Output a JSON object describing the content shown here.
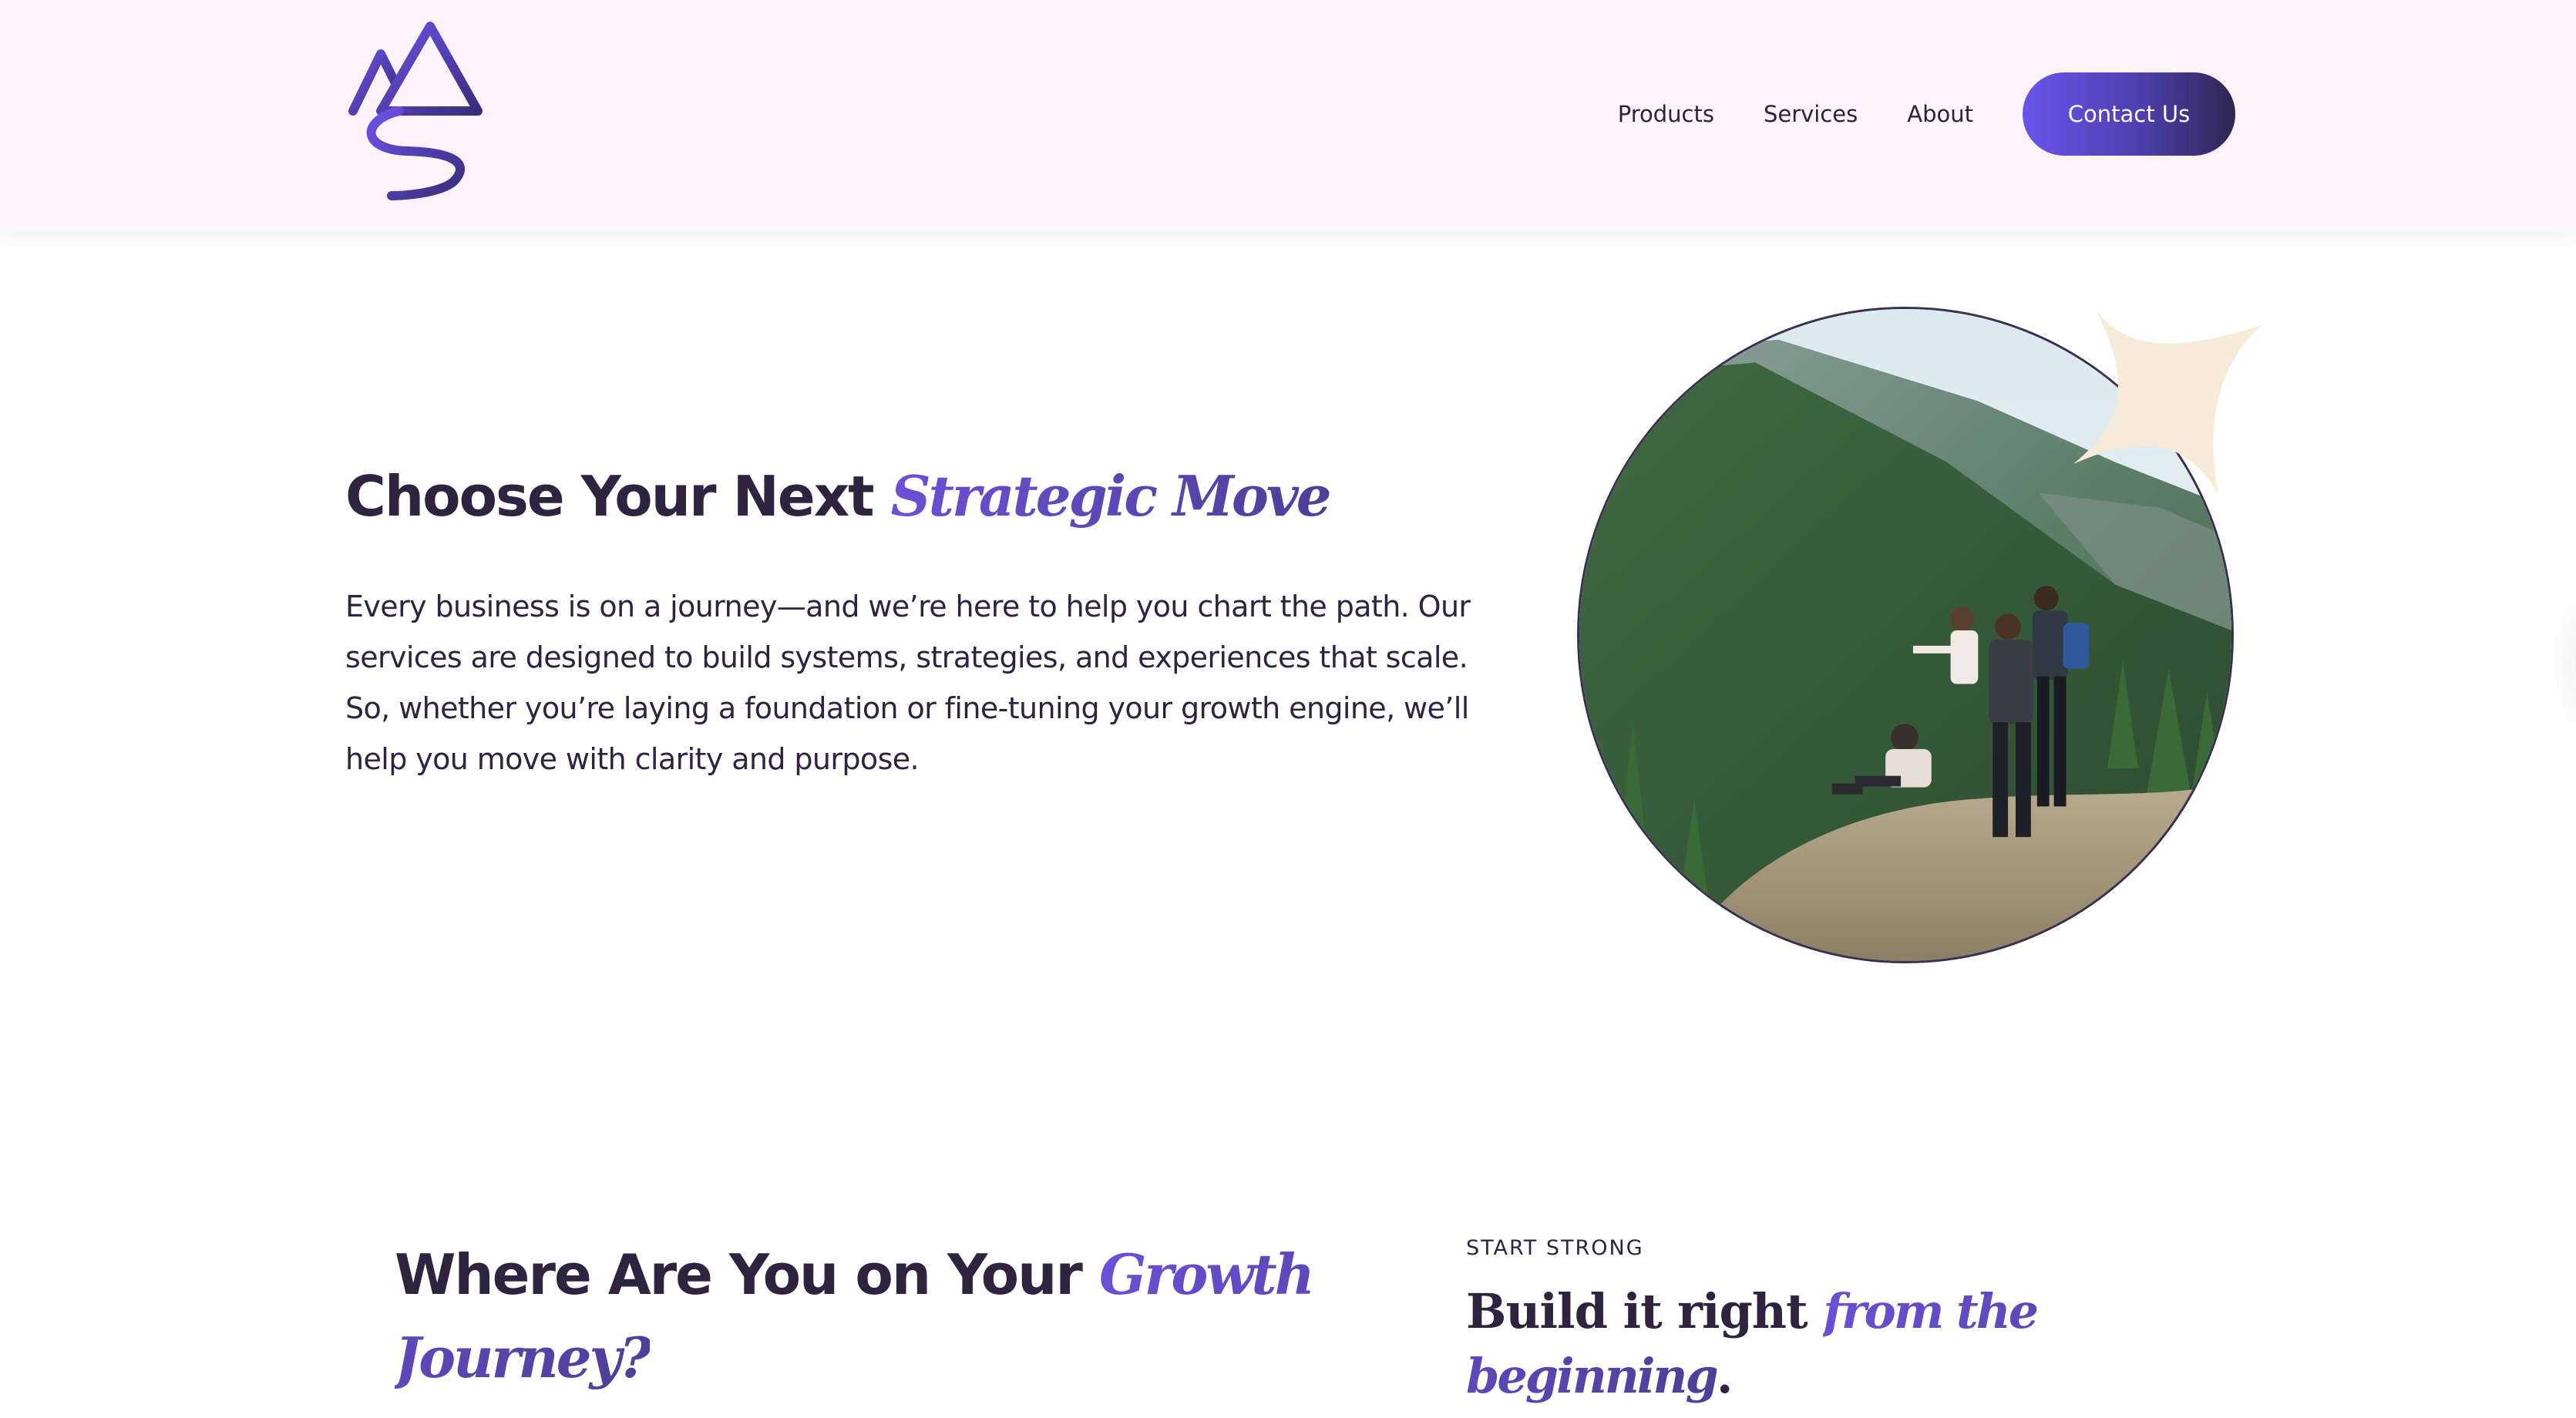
{
  "header": {
    "logo_name": "mountains-path-logo",
    "nav": {
      "products": "Products",
      "services": "Services",
      "about": "About"
    },
    "contact_label": "Contact Us"
  },
  "hero": {
    "title_plain": "Choose Your Next ",
    "title_accent": "Strategic Move",
    "body": "Every business is on a journey—and we’re here to help you chart the path. Our services are designed to build systems, strategies, and experiences that scale. So, whether you’re laying a foundation or fine-tuning your growth engine, we’ll help you move with clarity and purpose.",
    "image_subject": "hikers-on-mountain-photo"
  },
  "growth": {
    "title_plain": "Where Are You on Your ",
    "title_accent": "Growth Journey?"
  },
  "start": {
    "eyebrow": "START STRONG",
    "title_plain": "Build it right ",
    "title_accent": "from the beginning",
    "title_end": "."
  },
  "colors": {
    "header_bg": "#fdf3fb",
    "text_dark": "#2e2440",
    "accent_purple": "#6a50d6",
    "accent_deep": "#4e3f96",
    "sparkle": "#f6ebd9"
  }
}
